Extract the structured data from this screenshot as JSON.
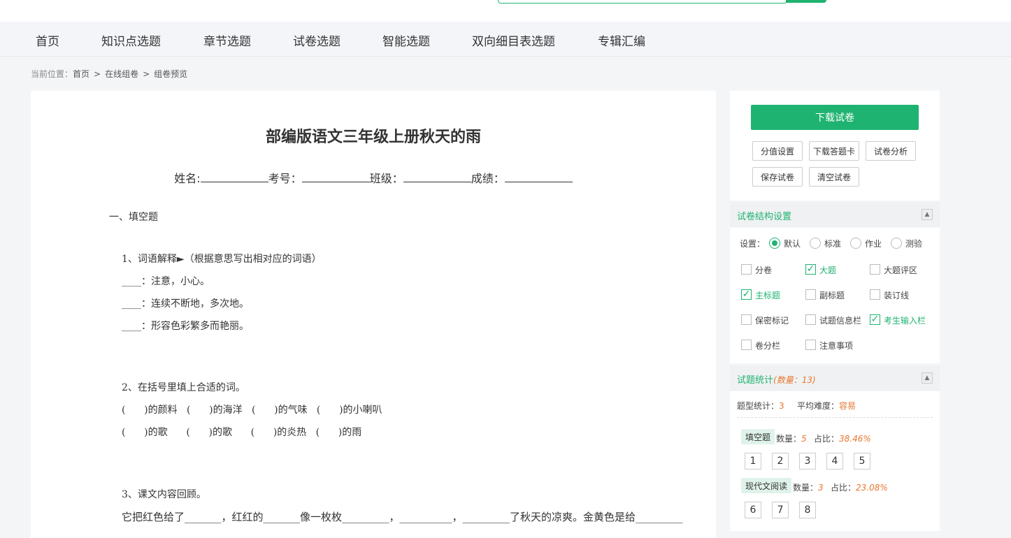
{
  "nav": [
    "首页",
    "知识点选题",
    "章节选题",
    "试卷选题",
    "智能选题",
    "双向细目表选题",
    "专辑汇编"
  ],
  "breadcrumb": {
    "label": "当前位置：",
    "items": [
      "首页",
      "在线组卷",
      "组卷预览"
    ],
    "sep": ">"
  },
  "paper": {
    "title": "部编版语文三年级上册秋天的雨",
    "info": {
      "name": "姓名:",
      "id": "考号：",
      "class": "班级：",
      "score": "成绩："
    },
    "section": "一、填空题",
    "q1": {
      "title": "1、词语解释►（根据意思写出相对应的词语）",
      "lines": [
        "____：注意，小心。",
        "____：连续不断地，多次地。",
        "____：形容色彩繁多而艳丽。"
      ]
    },
    "q2": {
      "title": "2、在括号里填上合适的词。",
      "lines": [
        "(      )的颜料   (      )的海洋   (      )的气味   (      )的小喇叭",
        "(      )的歌      (      )的歌      (      )的炎热   (      )的雨"
      ]
    },
    "q3": {
      "title": "3、课文内容回顾。",
      "line": "它把红色给了_______，红红的_______像一枚枚_________，__________，_________了秋天的凉爽。金黄色是给_________"
    }
  },
  "sidebar": {
    "download": "下载试卷",
    "buttons": [
      "分值设置",
      "下载答题卡",
      "试卷分析",
      "保存试卷",
      "清空试卷"
    ],
    "structure": {
      "title": "试卷结构设置",
      "setting_label": "设置：",
      "modes": [
        "默认",
        "标准",
        "作业",
        "测验"
      ],
      "selected_mode": "默认",
      "options": [
        {
          "label": "分卷",
          "checked": false
        },
        {
          "label": "大题",
          "checked": true
        },
        {
          "label": "大题评区",
          "checked": false
        },
        {
          "label": "主标题",
          "checked": true
        },
        {
          "label": "副标题",
          "checked": false
        },
        {
          "label": "装订线",
          "checked": false
        },
        {
          "label": "保密标记",
          "checked": false
        },
        {
          "label": "试题信息栏",
          "checked": false
        },
        {
          "label": "考生输入栏",
          "checked": true
        },
        {
          "label": "卷分栏",
          "checked": false
        },
        {
          "label": "注意事项",
          "checked": false
        }
      ]
    },
    "stats": {
      "title": "试题统计",
      "count_text": "(数量：13)",
      "type_label": "题型统计：",
      "type_count": "3",
      "difficulty_label": "平均难度：",
      "difficulty": "容易",
      "groups": [
        {
          "name": "填空题",
          "count_label": "数量：",
          "count": "5",
          "ratio_label": "占比：",
          "ratio": "38.46%",
          "items": [
            "1",
            "2",
            "3",
            "4",
            "5"
          ]
        },
        {
          "name": "现代文阅读",
          "count_label": "数量：",
          "count": "3",
          "ratio_label": "占比：",
          "ratio": "23.08%",
          "items": [
            "6",
            "7",
            "8"
          ]
        }
      ]
    },
    "colors": {
      "accent": "#1fb371",
      "highlight": "#e8772e"
    }
  }
}
